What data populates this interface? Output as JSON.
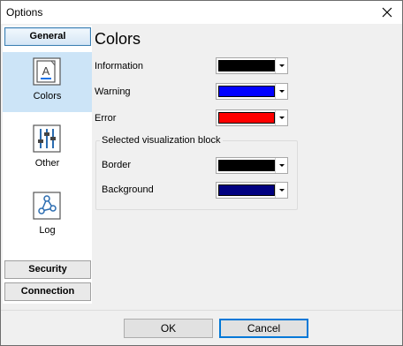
{
  "window": {
    "title": "Options"
  },
  "nav": {
    "groups": [
      {
        "label": "General"
      },
      {
        "label": "Security"
      },
      {
        "label": "Connection"
      }
    ],
    "items": [
      {
        "label": "Colors",
        "icon": "colors-icon"
      },
      {
        "label": "Other",
        "icon": "sliders-icon"
      },
      {
        "label": "Log",
        "icon": "log-icon"
      }
    ]
  },
  "main": {
    "heading": "Colors",
    "rows": [
      {
        "label": "Information",
        "color": "#000000"
      },
      {
        "label": "Warning",
        "color": "#0000ff"
      },
      {
        "label": "Error",
        "color": "#ff0000"
      }
    ],
    "group": {
      "title": "Selected visualization block",
      "rows": [
        {
          "label": "Border",
          "color": "#000000"
        },
        {
          "label": "Background",
          "color": "#000080"
        }
      ]
    }
  },
  "footer": {
    "ok": "OK",
    "cancel": "Cancel"
  }
}
